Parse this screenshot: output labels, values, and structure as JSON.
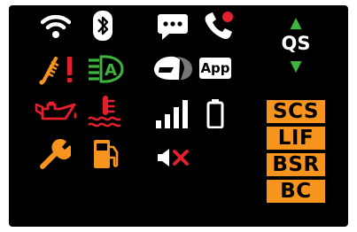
{
  "colors": {
    "background": "#000000",
    "status_white": "#ffffff",
    "warning_orange": "#f7941d",
    "alert_red": "#e5202e",
    "ok_green": "#3fb33f"
  },
  "icons": {
    "row1": [
      "wifi-icon",
      "bluetooth-icon",
      "message-icon",
      "phone-missed-call-icon"
    ],
    "row2": [
      "suspension-warning-icon",
      "auto-headlight-icon",
      "helmet-icon",
      "app-icon"
    ],
    "row3": [
      "oil-pressure-icon",
      "coolant-temperature-icon",
      "signal-strength-icon",
      "battery-icon"
    ],
    "row4": [
      "service-wrench-icon",
      "fuel-icon",
      "mute-icon"
    ]
  },
  "app_label": "App",
  "qs": {
    "label": "QS",
    "up": "▲",
    "down": "▼"
  },
  "badges": [
    "SCS",
    "LIF",
    "BSR",
    "BC"
  ]
}
